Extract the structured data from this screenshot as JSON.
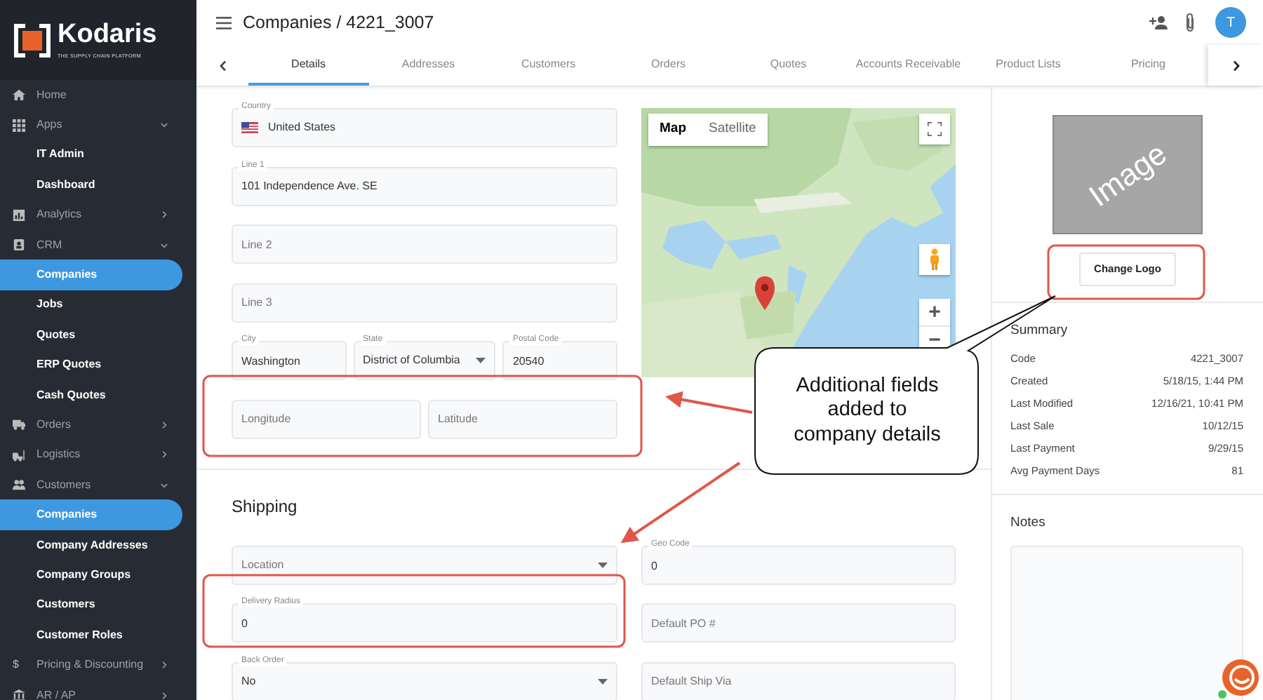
{
  "logo": {
    "name": "Kodaris",
    "tagline": "THE SUPPLY CHAIN PLATFORM"
  },
  "sidebar": {
    "items": [
      {
        "label": "Home",
        "kind": "home",
        "selected": false
      },
      {
        "label": "Apps",
        "kind": "grid",
        "selected": false,
        "expanded": true,
        "children": [
          {
            "label": "IT Admin",
            "selected": false
          },
          {
            "label": "Dashboard",
            "selected": false
          }
        ]
      },
      {
        "label": "Analytics",
        "kind": "chart",
        "selected": false,
        "expanded": false
      },
      {
        "label": "CRM",
        "kind": "badge",
        "selected": false,
        "expanded": true,
        "children": [
          {
            "label": "Companies",
            "selected": true
          },
          {
            "label": "Jobs",
            "selected": false
          },
          {
            "label": "Quotes",
            "selected": false
          },
          {
            "label": "ERP Quotes",
            "selected": false
          },
          {
            "label": "Cash Quotes",
            "selected": false
          }
        ]
      },
      {
        "label": "Orders",
        "kind": "truck",
        "selected": false,
        "expanded": false
      },
      {
        "label": "Logistics",
        "kind": "forklift",
        "selected": false,
        "expanded": false
      },
      {
        "label": "Customers",
        "kind": "people",
        "selected": false,
        "expanded": true,
        "children": [
          {
            "label": "Companies",
            "selected": true
          },
          {
            "label": "Company Addresses",
            "selected": false
          },
          {
            "label": "Company Groups",
            "selected": false
          },
          {
            "label": "Customers",
            "selected": false
          },
          {
            "label": "Customer Roles",
            "selected": false
          }
        ]
      },
      {
        "label": "Pricing & Discounting",
        "kind": "glyph",
        "glyph": "$",
        "selected": false,
        "expanded": false
      },
      {
        "label": "AR / AP",
        "kind": "bank",
        "selected": false,
        "expanded": false
      }
    ]
  },
  "header": {
    "title": "Companies / 4221_3007",
    "avatar": "T"
  },
  "tabs": [
    {
      "label": "Details",
      "selected": true
    },
    {
      "label": "Addresses",
      "selected": false
    },
    {
      "label": "Customers",
      "selected": false
    },
    {
      "label": "Orders",
      "selected": false
    },
    {
      "label": "Quotes",
      "selected": false
    },
    {
      "label": "Accounts Receivable",
      "selected": false
    },
    {
      "label": "Product Lists",
      "selected": false
    },
    {
      "label": "Pricing",
      "selected": false
    }
  ],
  "address": {
    "rows": [
      [
        {
          "kind": "flag",
          "label": "Country",
          "value": "United States"
        }
      ],
      [
        {
          "kind": "text",
          "label": "Line 1",
          "value": "101 Independence Ave. SE"
        }
      ],
      [
        {
          "kind": "text",
          "placeholder": "Line 2"
        }
      ],
      [
        {
          "kind": "text",
          "placeholder": "Line 3"
        }
      ],
      [
        {
          "kind": "text",
          "label": "City",
          "value": "Washington"
        },
        {
          "kind": "select",
          "label": "State",
          "value": "District of Columbia"
        },
        {
          "kind": "text",
          "label": "Postal Code",
          "value": "20540"
        }
      ],
      [
        {
          "kind": "text",
          "placeholder": "Longitude"
        },
        {
          "kind": "text",
          "placeholder": "Latitude"
        }
      ]
    ]
  },
  "map": {
    "kind": "picture",
    "modes": [
      {
        "label": "Map",
        "selected": true
      },
      {
        "label": "Satellite",
        "selected": false
      }
    ],
    "zoom_in": "+",
    "zoom_out": "−"
  },
  "shipping": {
    "title": "Shipping",
    "rows": [
      [
        {
          "kind": "select",
          "placeholder": "Location"
        },
        {
          "kind": "text",
          "label": "Geo Code",
          "value": "0"
        }
      ],
      [
        {
          "kind": "text",
          "label": "Delivery Radius",
          "value": "0"
        },
        {
          "kind": "text",
          "placeholder": "Default PO #"
        }
      ],
      [
        {
          "kind": "select",
          "label": "Back Order",
          "value": "No"
        },
        {
          "kind": "text",
          "placeholder": "Default Ship Via"
        }
      ]
    ]
  },
  "logo_panel": {
    "image_text": "Image",
    "button": "Change Logo"
  },
  "summary": {
    "title": "Summary",
    "rows": [
      {
        "label": "Code",
        "value": "4221_3007"
      },
      {
        "label": "Created",
        "value": "5/18/15, 1:44 PM"
      },
      {
        "label": "Last Modified",
        "value": "12/16/21, 10:41 PM"
      },
      {
        "label": "Last Sale",
        "value": "10/12/15"
      },
      {
        "label": "Last Payment",
        "value": "9/29/15"
      },
      {
        "label": "Avg Payment Days",
        "value": "81"
      }
    ]
  },
  "notes": {
    "title": "Notes"
  },
  "annotation": {
    "text": "Additional fields added to company details"
  }
}
